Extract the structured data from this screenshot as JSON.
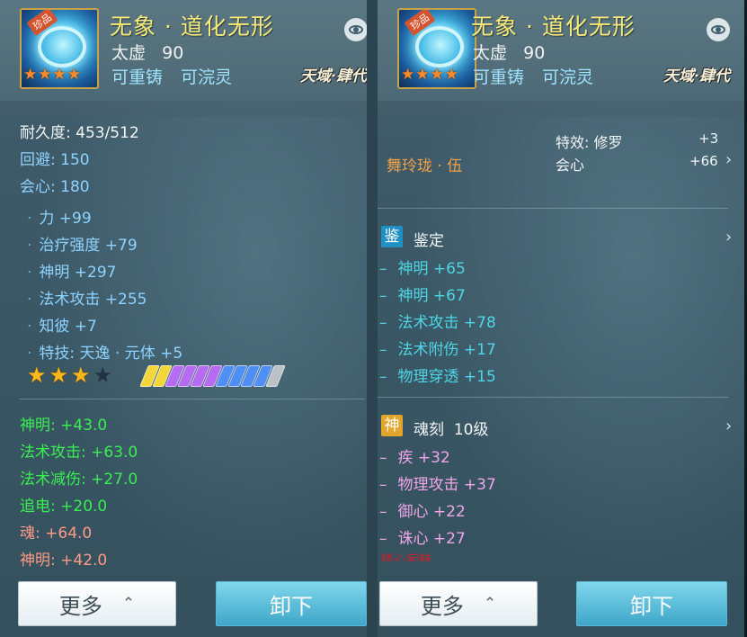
{
  "colors": {
    "name": "#f7ea7a",
    "blue_attr": "#8fd3ff",
    "green_attr": "#39ef52",
    "pink_attr": "#f1a6e8",
    "teal_attr": "#4fd6e6",
    "button_primary": "#3fa7c9"
  },
  "left": {
    "header": {
      "badge": "珍品",
      "name": "无象 · 道化无形",
      "level_label": "太虚",
      "level_value": "90",
      "tag1": "可重铸",
      "tag2": "可浣灵",
      "server": "天域·肆代",
      "stars": 4
    },
    "durability": "耐久度: 453/512",
    "base_stats": [
      {
        "label": "回避: 150"
      },
      {
        "label": "会心: 180"
      }
    ],
    "attrs": [
      "力 +99",
      "治疗强度 +79",
      "神明 +297",
      "法术攻击 +255",
      "知彼 +7",
      "特技: 天逸 · 元体 +5"
    ],
    "refine_stars": {
      "filled": 3,
      "total": 4
    },
    "gems": [
      "yellow",
      "yellow",
      "purple",
      "purple",
      "purple",
      "purple",
      "blue",
      "blue",
      "blue",
      "blue",
      "gray"
    ],
    "green_stats": [
      "神明: +43.0",
      "法术攻击: +63.0",
      "法术减伤: +27.0",
      "追电: +20.0"
    ],
    "red_stats": [
      "魂: +64.0",
      "神明: +42.0"
    ],
    "buttons": {
      "more": "更多",
      "unequip": "卸下"
    }
  },
  "right": {
    "header": {
      "badge": "珍品",
      "name": "无象 · 道化无形",
      "level_label": "太虚",
      "level_value": "90",
      "tag1": "可重铸",
      "tag2": "可浣灵",
      "server": "天域·肆代",
      "stars": 4
    },
    "set_name": "舞玲珑 · 伍",
    "effects": [
      {
        "label": "特效: 修罗",
        "value": "+3"
      },
      {
        "label": "会心",
        "value": "+66"
      }
    ],
    "appraise": {
      "icon": "鉴",
      "title": "鉴定",
      "items": [
        "神明 +65",
        "神明 +67",
        "法术攻击 +78",
        "法术附伤 +17",
        "物理穿透 +15"
      ]
    },
    "soul": {
      "icon": "神",
      "title": "魂刻",
      "level": "10级",
      "items": [
        "疾 +32",
        "物理攻击 +37",
        "御心 +22",
        "诛心 +27"
      ],
      "cut_text": "鳞心痴魅"
    },
    "buttons": {
      "more": "更多",
      "unequip": "卸下"
    }
  }
}
